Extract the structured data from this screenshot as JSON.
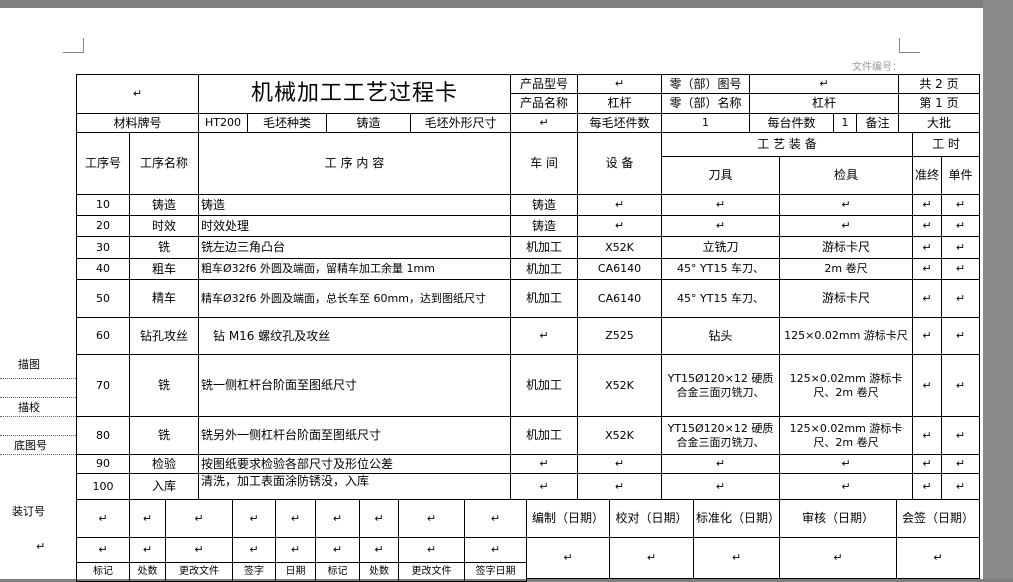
{
  "doc_number_label": "文件编号：",
  "title": "机械加工工艺过程卡",
  "para_mark": "↵",
  "header": {
    "product_model_label": "产品型号",
    "part_drawing_label": "零（部）图号",
    "total_pages_label": "共 2 页",
    "product_name_label": "产品名称",
    "product_name": "杠杆",
    "part_name_label": "零（部）名称",
    "part_name": "杠杆",
    "page_label": "第 1 页"
  },
  "material": {
    "material_label": "材料牌号",
    "material": "HT200",
    "blank_type_label": "毛坯种类",
    "blank_type": "铸造",
    "blank_size_label": "毛坯外形尺寸",
    "blanks_per_label": "每毛坯件数",
    "blanks_per": "1",
    "per_unit_label": "每台件数",
    "per_unit": "1",
    "note_label": "备注",
    "note": "大批"
  },
  "columns": {
    "op_no": "工序号",
    "op_name": "工序名称",
    "op_content": "工 序 内 容",
    "workshop": "车 间",
    "equipment": "设 备",
    "tooling": "工 艺 装 备",
    "cutter": "刀具",
    "gauge": "检具",
    "time": "工 时",
    "prep": "准终",
    "unit": "单件"
  },
  "operations": [
    {
      "no": "10",
      "name": "铸造",
      "content": "铸造",
      "shop": "铸造",
      "equip": "",
      "tool": "",
      "gauge": ""
    },
    {
      "no": "20",
      "name": "时效",
      "content": "时效处理",
      "shop": "铸造",
      "equip": "",
      "tool": "",
      "gauge": ""
    },
    {
      "no": "30",
      "name": "铣",
      "content": "铣左边三角凸台",
      "shop": "机加工",
      "equip": "X52K",
      "tool": "立铣刀",
      "gauge": "游标卡尺"
    },
    {
      "no": "40",
      "name": "粗车",
      "content": "粗车Ø32f6 外圆及端面，留精车加工余量 1mm",
      "shop": "机加工",
      "equip": "CA6140",
      "tool": "45° YT15 车刀、",
      "gauge": "2m 卷尺"
    },
    {
      "no": "50",
      "name": "精车",
      "content": "精车Ø32f6 外圆及端面，总长车至 60mm，达到图纸尺寸",
      "shop": "机加工",
      "equip": "CA6140",
      "tool": "45° YT15 车刀、",
      "gauge": "游标卡尺"
    },
    {
      "no": "60",
      "name": "钻孔攻丝",
      "content": "钻 M16 螺纹孔及攻丝",
      "shop": "",
      "equip": "Z525",
      "tool": "钻头",
      "gauge": "125×0.02mm 游标卡尺"
    },
    {
      "no": "70",
      "name": "铣",
      "content": "铣一侧杠杆台阶面至图纸尺寸",
      "shop": "机加工",
      "equip": "X52K",
      "tool": "YT15Ø120×12 硬质合金三面刃铣刀、",
      "gauge": "125×0.02mm 游标卡尺、2m 卷尺"
    },
    {
      "no": "80",
      "name": "铣",
      "content": "铣另外一侧杠杆台阶面至图纸尺寸",
      "shop": "机加工",
      "equip": "X52K",
      "tool": "YT15Ø120×12 硬质合金三面刃铣刀、",
      "gauge": "125×0.02mm 游标卡尺、2m 卷尺"
    },
    {
      "no": "90",
      "name": "检验",
      "content": "按图纸要求检验各部尺寸及形位公差",
      "shop": "",
      "equip": "",
      "tool": "",
      "gauge": ""
    },
    {
      "no": "100",
      "name": "入库",
      "content": "清洗，加工表面涂防锈没，入库",
      "shop": "",
      "equip": "",
      "tool": "",
      "gauge": ""
    }
  ],
  "side_labels": {
    "draw": "描图",
    "trace": "描校",
    "base_drawing": "底图号",
    "binding": "装订号"
  },
  "signoff": {
    "compile": "编制（日期）",
    "proof": "校对（日期）",
    "standard": "标准化（日期）",
    "review": "审核（日期）",
    "countersign": "会签（日期）"
  },
  "bottom_labels": [
    "标记",
    "处数",
    "更改文件",
    "签字",
    "日期",
    "标记",
    "处数",
    "更改文件",
    "签字日期"
  ]
}
